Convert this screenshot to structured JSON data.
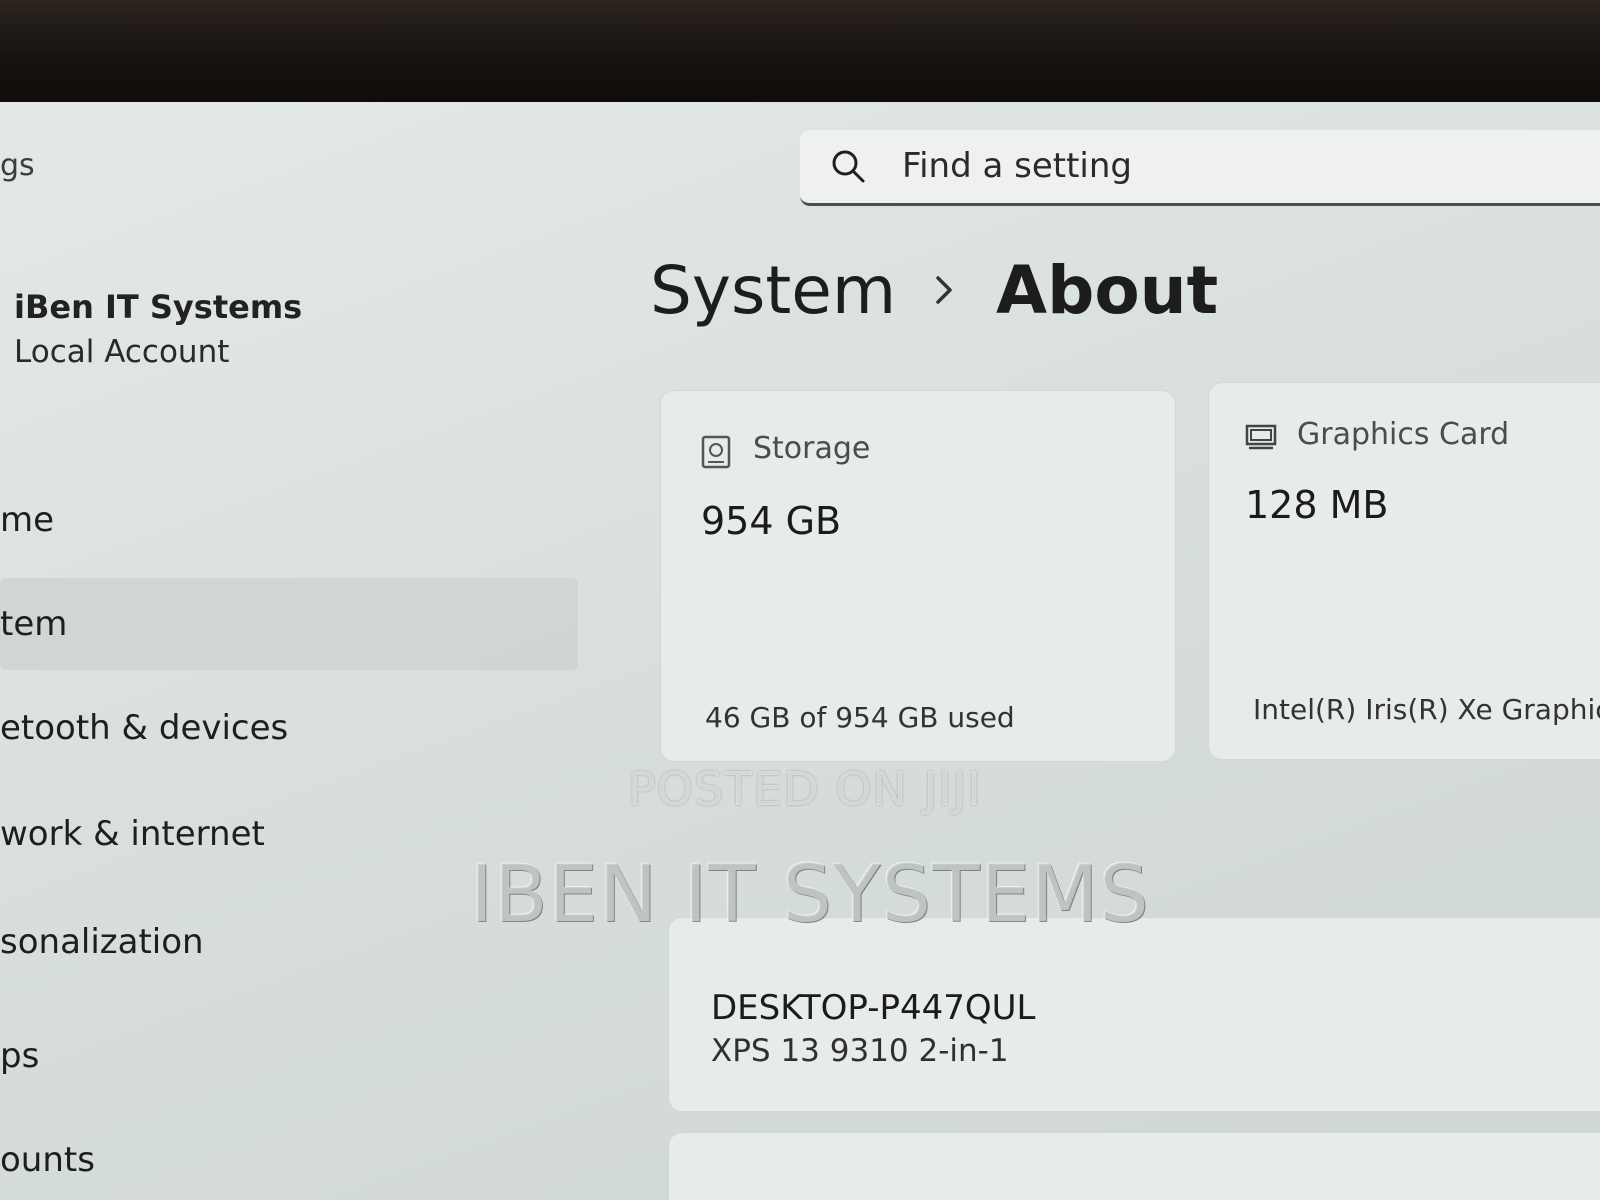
{
  "window": {
    "title": "gs"
  },
  "account": {
    "name": "iBen IT Systems",
    "type": "Local Account"
  },
  "sidebar": {
    "items": [
      {
        "label": "me"
      },
      {
        "label": "tem",
        "selected": true
      },
      {
        "label": "etooth & devices"
      },
      {
        "label": "work & internet"
      },
      {
        "label": "sonalization"
      },
      {
        "label": "ps"
      },
      {
        "label": "ounts"
      }
    ]
  },
  "search": {
    "placeholder": "Find a setting",
    "icon": "search-icon"
  },
  "breadcrumb": {
    "parent": "System",
    "current": "About"
  },
  "cards": {
    "storage": {
      "icon": "storage-icon",
      "label": "Storage",
      "value": "954 GB",
      "detail": "46 GB of 954 GB used"
    },
    "graphics": {
      "icon": "graphics-card-icon",
      "label": "Graphics Card",
      "value": "128 MB",
      "detail": "Intel(R) Iris(R) Xe Graphics"
    }
  },
  "device": {
    "name": "DESKTOP-P447QUL",
    "model": "XPS 13 9310 2-in-1"
  },
  "watermarks": {
    "small": "POSTED ON JIJI",
    "large": "IBEN IT SYSTEMS"
  },
  "colors": {
    "background": "#d9e0dd",
    "card": "#e7ebe9",
    "text": "#1b1b1b",
    "bezel": "#0c0a09"
  }
}
